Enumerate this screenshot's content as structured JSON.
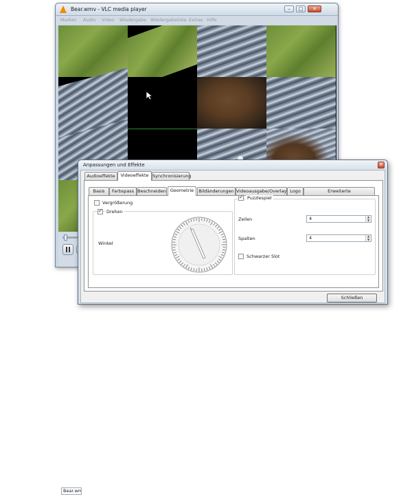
{
  "vlc": {
    "title": "Bear.wmv - VLC media player",
    "menu": [
      "Medien",
      "Audio",
      "Video",
      "Wiedergabe",
      "Wiedergabeliste",
      "Extras",
      "Hilfe"
    ],
    "status_file": "Bear.wmv",
    "window_buttons": {
      "minimize": "–",
      "maximize": "□",
      "close": "✕"
    }
  },
  "dialog": {
    "title": "Anpassungen und Effekte",
    "close_glyph": "✕",
    "main_tabs": [
      "Audioeffekte",
      "Videoeffekte",
      "Synchronisierung"
    ],
    "active_main_tab": "Videoeffekte",
    "sub_tabs": [
      "Basis",
      "Farbspass",
      "Beschneiden",
      "Geometrie",
      "Bildänderungen",
      "Videoausgabe/Overlay",
      "Logo",
      "Erweiterte Videofiltersteuerungen"
    ],
    "active_sub_tab": "Geometrie",
    "geometry": {
      "magnify_label": "Vergrößerung",
      "magnify_checked": false,
      "rotate_label": "Drehen",
      "rotate_checked": true,
      "angle_label": "Winkel",
      "puzzle_label": "Puzzlespiel",
      "puzzle_checked": true,
      "rows_label": "Zeilen",
      "rows_value": "4",
      "cols_label": "Spalten",
      "cols_value": "4",
      "black_slot_label": "Schwarzer Slot",
      "black_slot_checked": false
    },
    "close_button": "Schließen"
  },
  "colors": {
    "accent": "#2b3f8c",
    "window_frame": "#c8d6e4",
    "dialog_frame": "#d8e2ec"
  }
}
